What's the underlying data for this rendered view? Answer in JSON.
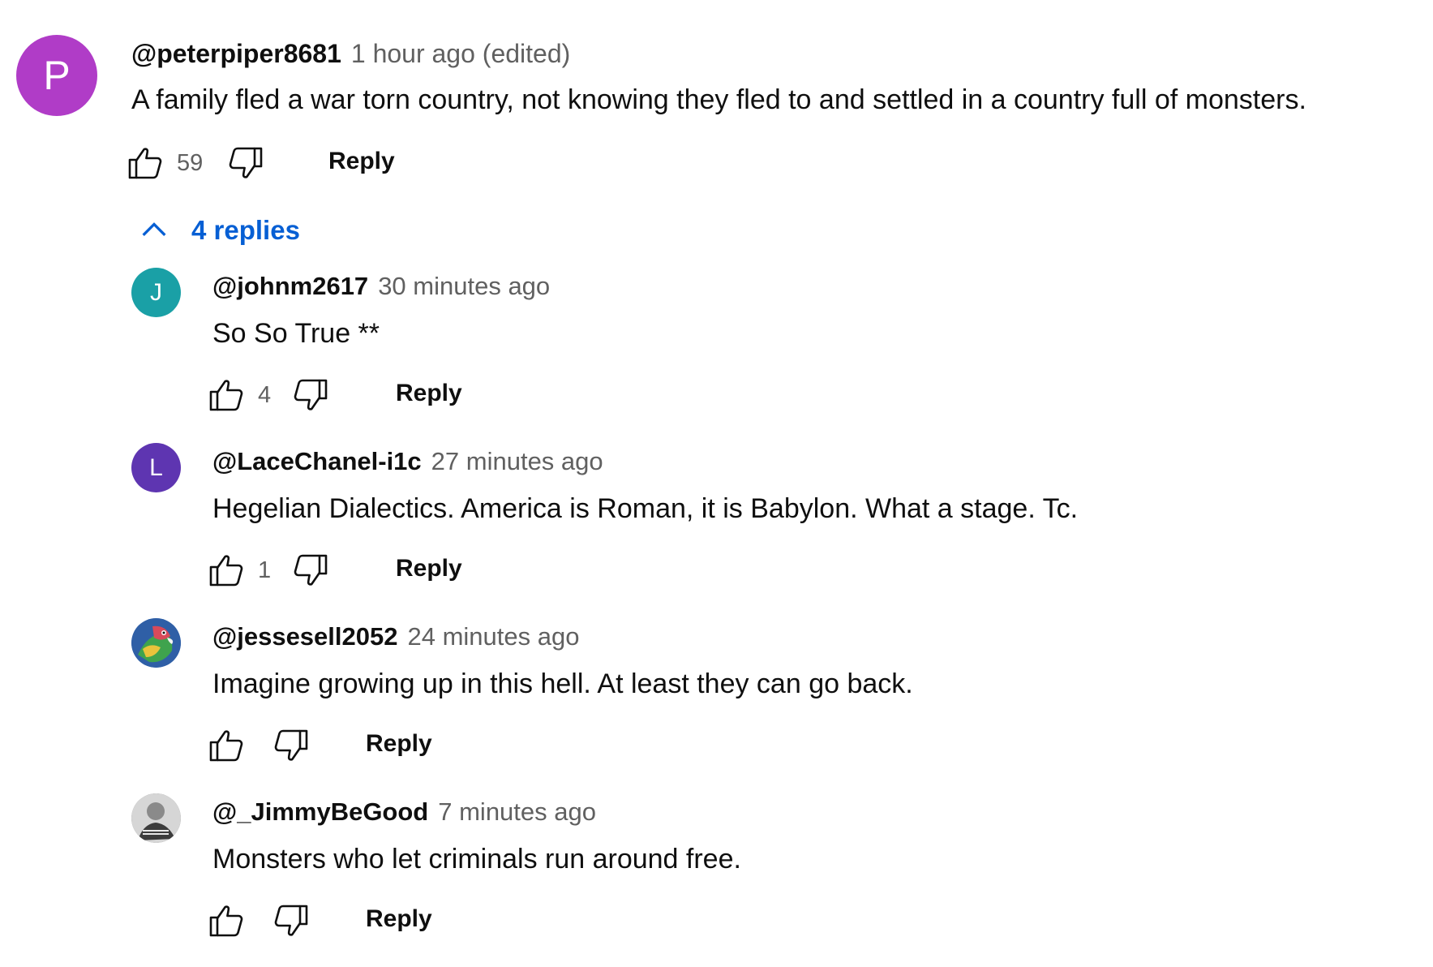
{
  "main_comment": {
    "avatar_letter": "P",
    "avatar_color": "#b03cc7",
    "author": "@peterpiper8681",
    "time": "1 hour ago (edited)",
    "text": "A family fled a war torn country, not knowing they fled to and settled in a country full of monsters.",
    "likes": "59",
    "reply_label": "Reply"
  },
  "replies_toggle": {
    "label": "4 replies",
    "icon": "chevron-up-icon",
    "color": "#065fd4"
  },
  "replies": [
    {
      "avatar_letter": "J",
      "avatar_color": "#1aa0a6",
      "author": "@johnm2617",
      "time": "30 minutes ago",
      "text": "So So True **",
      "likes": "4",
      "reply_label": "Reply"
    },
    {
      "avatar_letter": "L",
      "avatar_color": "#5e35b1",
      "author": "@LaceChanel-i1c",
      "time": "27 minutes ago",
      "text": "Hegelian Dialectics. America is Roman, it is Babylon. What a stage. Tc.",
      "likes": "1",
      "reply_label": "Reply"
    },
    {
      "avatar_letter": "",
      "avatar_color": "#3a6bb5",
      "author": "@jessesell2052",
      "time": "24 minutes ago",
      "text": "Imagine growing up in this hell. At least they can go back.",
      "likes": "",
      "reply_label": "Reply"
    },
    {
      "avatar_letter": "",
      "avatar_color": "#9a9a9a",
      "author": "@_JimmyBeGood",
      "time": "7 minutes ago",
      "text": "Monsters who let criminals run around free.",
      "likes": "",
      "reply_label": "Reply"
    }
  ]
}
